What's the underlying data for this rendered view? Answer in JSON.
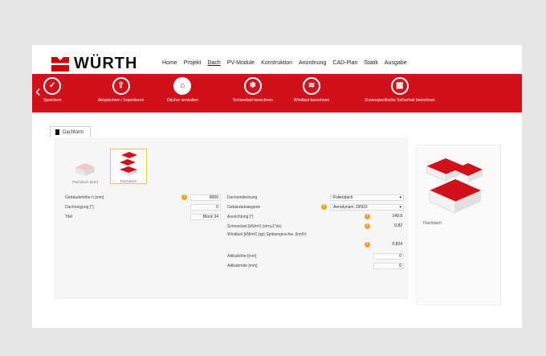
{
  "brand": {
    "name": "WÜRTH",
    "accent": "#d0101a",
    "warning": "#f0a020"
  },
  "topnav": [
    "Home",
    "Projekt",
    "Dach",
    "PV-Module",
    "Konstruktion",
    "Anordnung",
    "CAD-Plan",
    "Statik",
    "Ausgabe"
  ],
  "topnav_active": "Dach",
  "toolbar": [
    {
      "icon": "check-icon",
      "label": "Speichern"
    },
    {
      "icon": "export-icon",
      "label": "Abspeichern / Importieren"
    },
    {
      "icon": "roof-manage-icon",
      "label": "Dächer verwalten"
    },
    {
      "icon": "snow-icon",
      "label": "Schneelast berechnen"
    },
    {
      "icon": "wind-icon",
      "label": "Windlast berechnen"
    },
    {
      "icon": "calc-icon",
      "label": "Zonenspezifische Sicherheit berechnen"
    }
  ],
  "tab": {
    "label": "Dachform"
  },
  "thumbs": [
    {
      "label": "Flachdach (leer)",
      "selected": false
    },
    {
      "label": "Flachdach",
      "selected": true
    }
  ],
  "form_left": [
    {
      "label": "Gebäudehöhe h [mm]",
      "value": "8000",
      "warn": true
    },
    {
      "label": "Dachneigung [°]",
      "value": "0",
      "warn": false
    },
    {
      "label": "Titel",
      "value": "Block 34",
      "warn": false
    }
  ],
  "form_right": [
    {
      "label": "Dacheindeckung",
      "value": "Foliendach",
      "select": true,
      "warn": false
    },
    {
      "label": "Gebäudekategorie",
      "value": "Aerodynam. DIN10",
      "select": true,
      "warn": true
    },
    {
      "label": "Ausrichtung [°]",
      "value": "149,9",
      "warn": true
    },
    {
      "label": "Schneelast [kN/m²] (sk=μ1*sk)",
      "value": "0,82",
      "warn": true
    },
    {
      "label": "Windlast [kN/m²] (qp) Spitzengeschw. (km/h)",
      "value": "0,834",
      "warn": true,
      "tall": true
    },
    {
      "label": "Attikahöhe [mm]",
      "value": "0",
      "warn": false
    },
    {
      "label": "Attikabreite [mm]",
      "value": "0",
      "warn": false
    }
  ],
  "preview": {
    "caption": "Flachdach"
  }
}
